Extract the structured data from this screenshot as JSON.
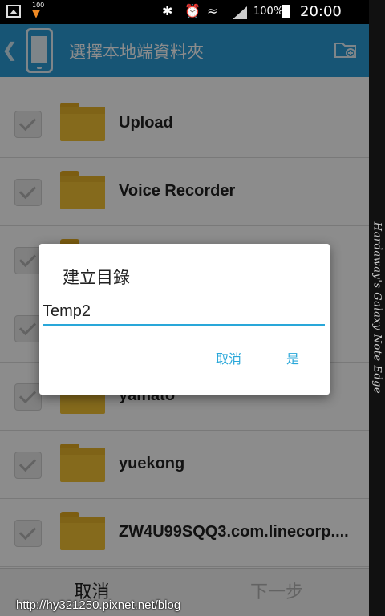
{
  "status_bar": {
    "notification_badge": "100",
    "battery_percent": "100%",
    "time": "20:00",
    "icons": [
      "gallery-icon",
      "download-icon",
      "bluetooth-icon",
      "alarm-icon",
      "wifi-icon",
      "signal-icon",
      "battery-icon"
    ]
  },
  "app_bar": {
    "title": "選擇本地端資料夾",
    "back_icon": "chevron-left-icon",
    "device_icon": "phone-icon",
    "action_icon": "new-folder-icon",
    "color": "#2a9bd6"
  },
  "folders": [
    {
      "name": "Upload"
    },
    {
      "name": "Voice Recorder"
    },
    {
      "name": ""
    },
    {
      "name": ""
    },
    {
      "name": "yamato"
    },
    {
      "name": "yuekong"
    },
    {
      "name": "ZW4U99SQQ3.com.linecorp...."
    }
  ],
  "bottom_bar": {
    "cancel_label": "取消",
    "next_label": "下一步"
  },
  "dialog": {
    "title": "建立目錄",
    "input_value": "Temp2",
    "cancel_label": "取消",
    "confirm_label": "是",
    "accent_color": "#29a7d9"
  },
  "watermark": "http://hy321250.pixnet.net/blog",
  "edge_text": "Hardaway's Galaxy Note Edge"
}
